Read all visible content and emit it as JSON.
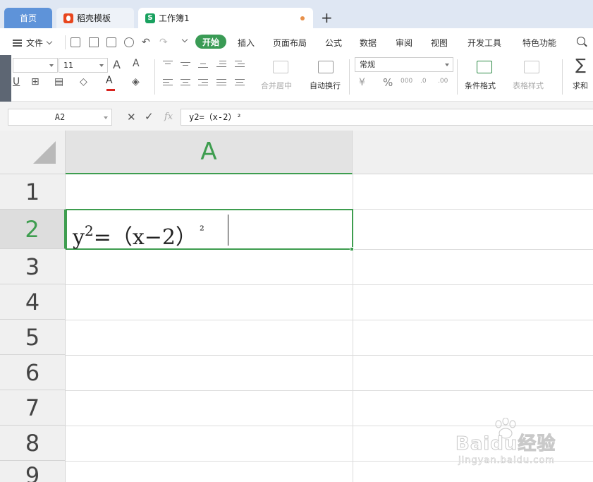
{
  "tabs": {
    "home": "首页",
    "template": "稻壳模板",
    "workbook": "工作簿1",
    "workbook_logo": "S",
    "new_tab": "+"
  },
  "menu": {
    "file": "文件",
    "items": [
      "开始",
      "插入",
      "页面布局",
      "公式",
      "数据",
      "审阅",
      "视图",
      "开发工具",
      "特色功能"
    ]
  },
  "toolbar": {
    "font_size": "11",
    "merge_center": "合并居中",
    "wrap_text": "自动换行",
    "number_format": "常规",
    "conditional_format": "条件格式",
    "table_style": "表格样式",
    "sum": "求和",
    "percent": "%"
  },
  "formula_bar": {
    "name_box": "A2",
    "fx": "fx",
    "formula": "y2=（x-2）²"
  },
  "sheet": {
    "column_header": "A",
    "row_headers": [
      "1",
      "2",
      "3",
      "4",
      "5",
      "6",
      "7",
      "8",
      "9"
    ],
    "active_cell": {
      "base": "y",
      "exponent": "2",
      "rest": "=（x−2）",
      "superscript_char": "²"
    }
  },
  "watermark": {
    "brand": "Baidu经验",
    "domain": "jingyan.baidu.com"
  },
  "colors": {
    "accent_green": "#3e9d4f",
    "home_tab_blue": "#5e93d9",
    "font_color_red": "#d8231e"
  }
}
